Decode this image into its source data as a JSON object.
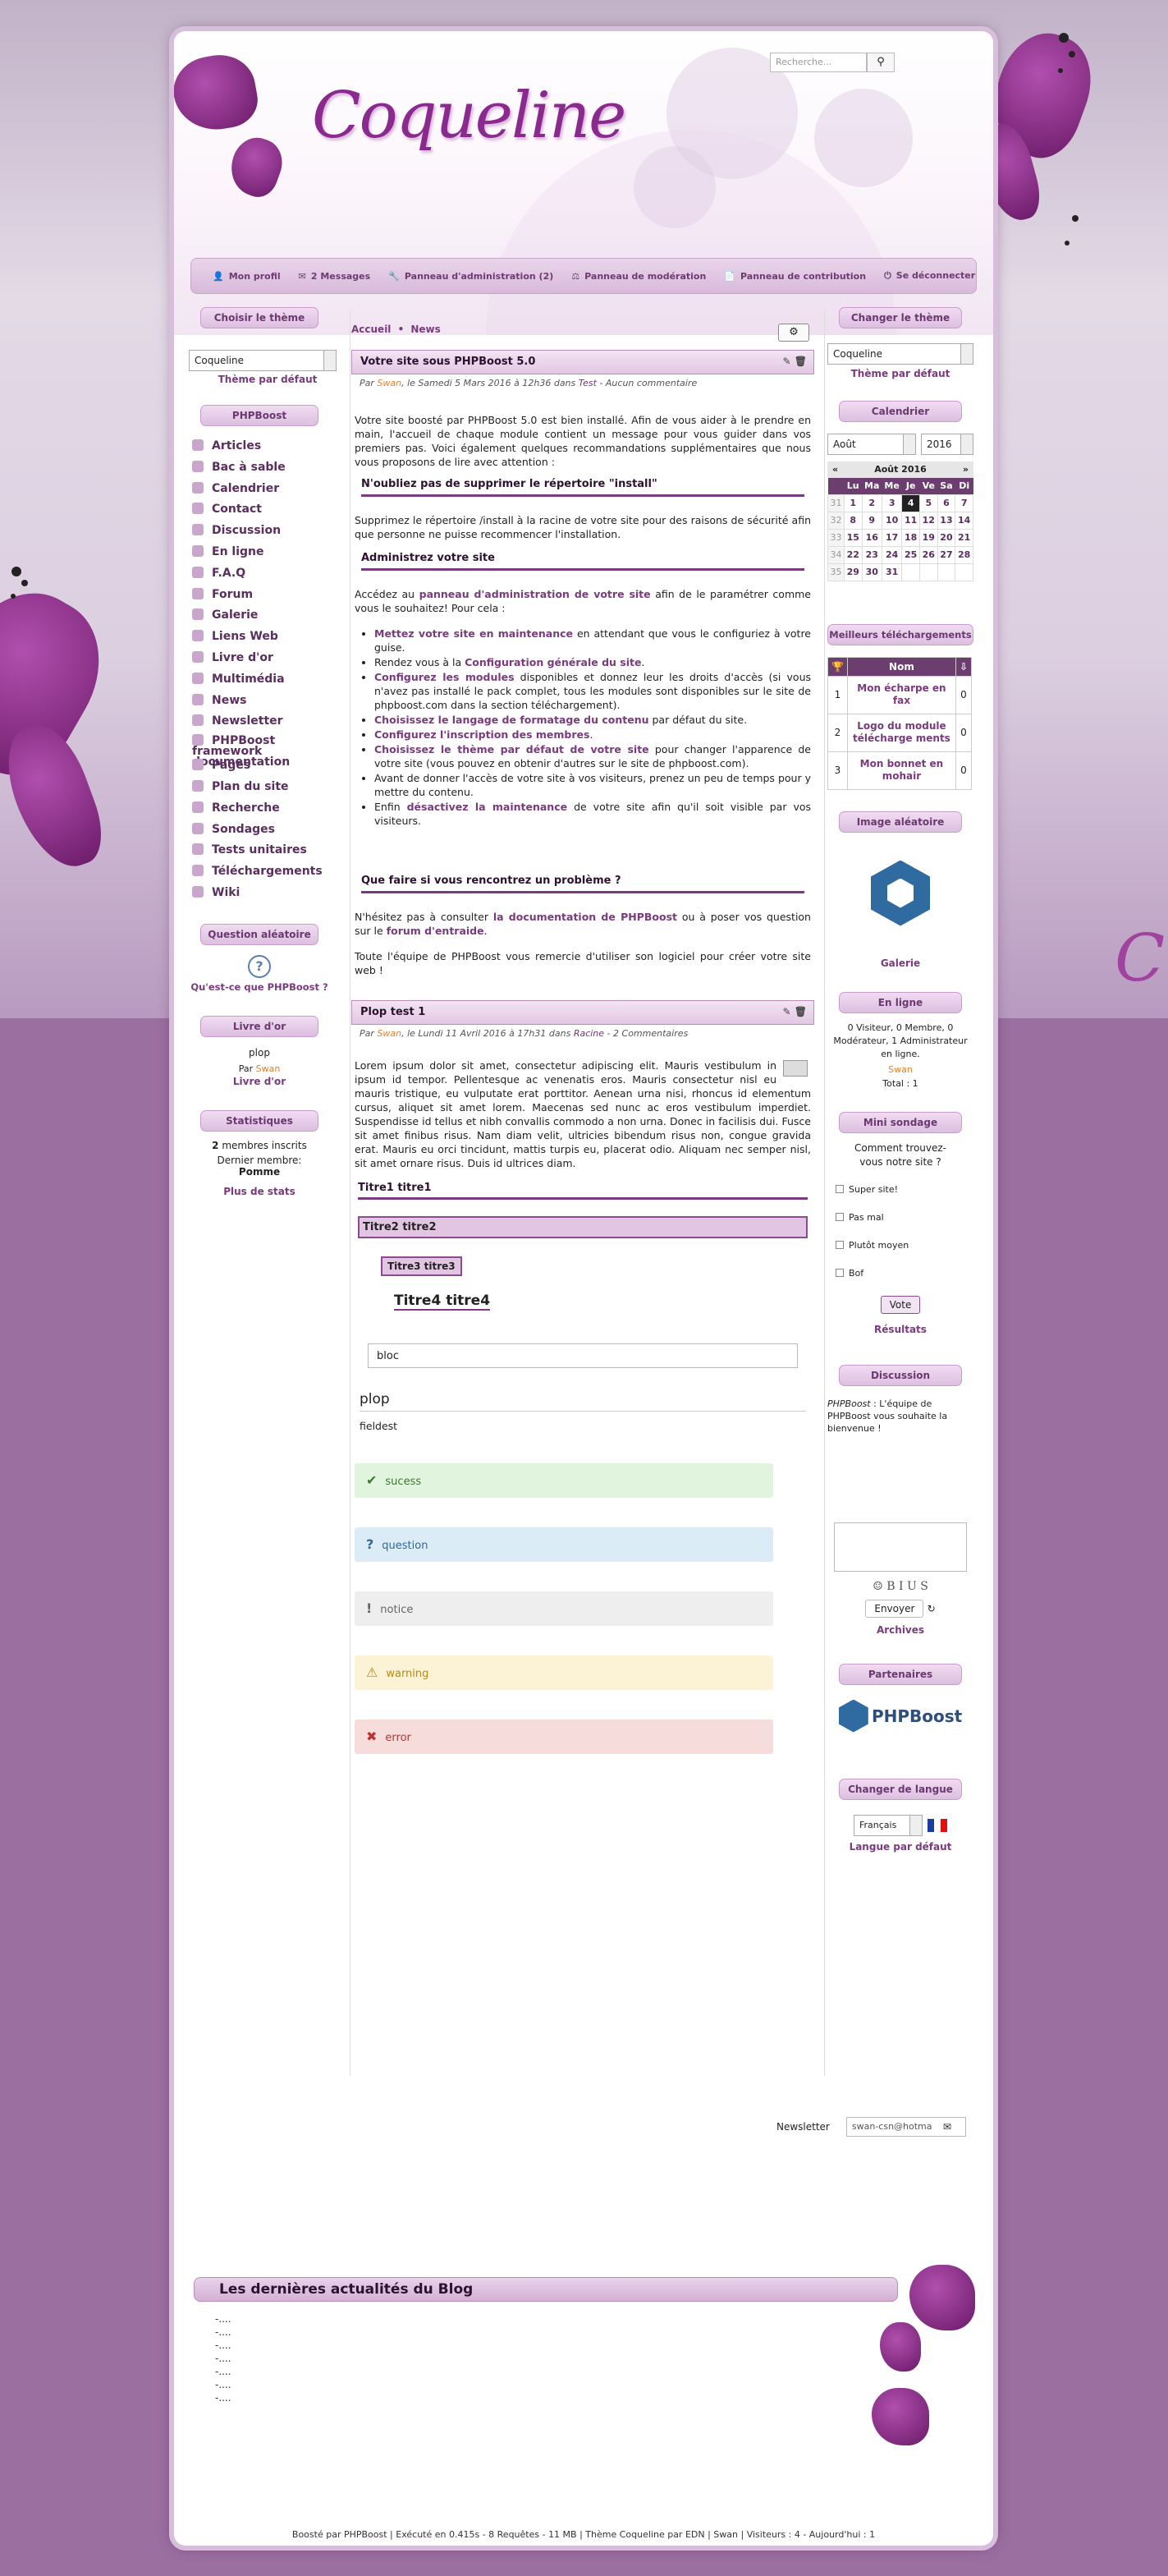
{
  "site": {
    "logo": "Coqueline",
    "search_placeholder": "Recherche..."
  },
  "menu": [
    {
      "icon": "person-icon",
      "label": "Mon profil"
    },
    {
      "icon": "mail-icon",
      "label": "2 Messages"
    },
    {
      "icon": "wrench-icon",
      "label": "Panneau d'administration (2)"
    },
    {
      "icon": "gavel-icon",
      "label": "Panneau de modération"
    },
    {
      "icon": "file-icon",
      "label": "Panneau de contribution"
    },
    {
      "icon": "logout-icon",
      "label": "Se déconnecter"
    }
  ],
  "left": {
    "theme": {
      "title": "Choisir le thème",
      "value": "Coqueline",
      "default_link": "Thème par défaut"
    },
    "phpboost": {
      "title": "PHPBoost",
      "items": [
        "Articles",
        "Bac à sable",
        "Calendrier",
        "Contact",
        "Discussion",
        "En ligne",
        "F.A.Q",
        "Forum",
        "Galerie",
        "Liens Web",
        "Livre d'or",
        "Multimédia",
        "News",
        "Newsletter",
        "PHPBoost framework documentation",
        "Pages",
        "Plan du site",
        "Recherche",
        "Sondages",
        "Tests unitaires",
        "Téléchargements",
        "Wiki"
      ]
    },
    "question": {
      "title": "Question aléatoire",
      "link": "Qu'est-ce que PHPBoost ?"
    },
    "guestbook": {
      "title": "Livre d'or",
      "text": "plop",
      "by": "Par",
      "author": "Swan",
      "link": "Livre d'or"
    },
    "stats": {
      "title": "Statistiques",
      "members_count": "2",
      "members_label": "membres inscrits",
      "last_label": "Dernier membre:",
      "last_name": "Pomme",
      "link": "Plus de stats"
    }
  },
  "breadcrumb": {
    "home": "Accueil",
    "sep": "•",
    "current": "News"
  },
  "articles": [
    {
      "title": "Votre site sous PHPBoost 5.0",
      "meta_by": "Par",
      "author": "Swan",
      "meta_date": ", le Samedi 5 Mars 2016 à 12h36 dans",
      "category": "Test",
      "meta_comments": "- Aucun commentaire"
    },
    {
      "title": "Plop test 1",
      "meta_by": "Par",
      "author": "Swan",
      "meta_date": ", le Lundi 11 Avril 2016 à 17h31 dans",
      "category": "Racine",
      "meta_comments": "- 2 Commentaires"
    }
  ],
  "a1": {
    "p1": "Votre site boosté par PHPBoost 5.0 est bien installé. Afin de vous aider à le prendre en main, l'accueil de chaque module contient un message pour vous guider dans vos premiers pas. Voici également quelques recommandations supplémentaires que nous vous proposons de lire avec attention :",
    "h1": "N'oubliez pas de supprimer le répertoire \"install\"",
    "p2": "Supprimez le répertoire /install à la racine de votre site pour des raisons de sécurité afin que personne ne puisse recommencer l'installation.",
    "h2": "Administrez votre site",
    "p3a": "Accédez au",
    "p3link": "panneau d'administration de votre site",
    "p3b": "afin de le paramétrer comme vous le souhaitez! Pour cela :",
    "list": [
      {
        "link": "Mettez votre site en maintenance",
        "text": " en attendant que vous le configuriez à votre guise."
      },
      {
        "pre": "Rendez vous à la ",
        "link": "Configuration générale du site",
        "text": "."
      },
      {
        "link": "Configurez les modules",
        "text": " disponibles et donnez leur les droits d'accès (si vous n'avez pas installé le pack complet, tous les modules sont disponibles sur le site de phpboost.com dans la section téléchargement)."
      },
      {
        "link": "Choisissez le langage de formatage du contenu",
        "text": " par défaut du site."
      },
      {
        "link": "Configurez l'inscription des membres",
        "text": "."
      },
      {
        "link": "Choisissez le thème par défaut de votre site",
        "text": " pour changer l'apparence de votre site (vous pouvez en obtenir d'autres sur le site de phpboost.com)."
      },
      {
        "text": "Avant de donner l'accès de votre site à vos visiteurs, prenez un peu de temps pour y mettre du contenu."
      },
      {
        "pre": "Enfin ",
        "link": "désactivez la maintenance",
        "text": " de votre site afin qu'il soit visible par vos visiteurs."
      }
    ],
    "h3": "Que faire si vous rencontrez un problème ?",
    "p4a": "N'hésitez pas à consulter",
    "p4link1": "la documentation de PHPBoost",
    "p4b": "ou à poser vos question sur le",
    "p4link2": "forum d'entraide",
    "p5": "Toute l'équipe de PHPBoost vous remercie d'utiliser son logiciel pour créer votre site web !"
  },
  "a2": {
    "lorem": "Lorem ipsum dolor sit amet, consectetur adipiscing elit. Mauris vestibulum in ipsum id tempor. Pellentesque ac venenatis eros. Mauris consectetur nisl eu mauris tristique, eu vulputate erat porttitor. Aenean urna nisi, rhoncus id elementum cursus, aliquet sit amet lorem. Maecenas sed nunc ac eros vestibulum imperdiet. Suspendisse id tellus et nibh convallis commodo a non urna. Donec in facilisis dui. Fusce sit amet finibus risus. Nam diam velit, ultricies bibendum risus non, congue gravida erat. Mauris eu orci tincidunt, mattis turpis eu, placerat odio. Aliquam nec semper nisl, sit amet ornare risus. Duis id ultrices diam.",
    "t1": "Titre1 titre1",
    "t2": "Titre2 titre2",
    "t3": "Titre3 titre3",
    "t4": "Titre4 titre4",
    "bloc": "bloc",
    "legend": "plop",
    "fieldset": "fieldest",
    "msgs": [
      {
        "type": "success",
        "icon": "check-icon",
        "text": "sucess"
      },
      {
        "type": "question",
        "icon": "question-icon",
        "text": "question"
      },
      {
        "type": "notice",
        "icon": "exclamation-icon",
        "text": "notice"
      },
      {
        "type": "warning",
        "icon": "warning-icon",
        "text": "warning"
      },
      {
        "type": "error",
        "icon": "close-icon",
        "text": "error"
      }
    ]
  },
  "right": {
    "theme": {
      "title": "Changer le thème",
      "value": "Coqueline",
      "default_link": "Thème par défaut"
    },
    "calendar": {
      "title": "Calendrier",
      "month": "Août",
      "year": "2016",
      "label": "Août 2016",
      "prev": "«",
      "next": "»",
      "days": [
        "Lu",
        "Ma",
        "Me",
        "Je",
        "Ve",
        "Sa",
        "Di"
      ],
      "weeks": [
        [
          "31",
          "1",
          "2",
          "3",
          "4",
          "5",
          "6",
          "7"
        ],
        [
          "32",
          "8",
          "9",
          "10",
          "11",
          "12",
          "13",
          "14"
        ],
        [
          "33",
          "15",
          "16",
          "17",
          "18",
          "19",
          "20",
          "21"
        ],
        [
          "34",
          "22",
          "23",
          "24",
          "25",
          "26",
          "27",
          "28"
        ],
        [
          "35",
          "29",
          "30",
          "31",
          "",
          "",
          "",
          ""
        ]
      ]
    },
    "downloads": {
      "title": "Meilleurs téléchargements",
      "col": "Nom",
      "rows": [
        [
          "1",
          "Mon écharpe en fax",
          "0"
        ],
        [
          "2",
          "Logo du module télécharge ments",
          "0"
        ],
        [
          "3",
          "Mon bonnet en mohair",
          "0"
        ]
      ]
    },
    "image": {
      "title": "Image aléatoire",
      "link": "Galerie"
    },
    "online": {
      "title": "En ligne",
      "text": "0 Visiteur, 0 Membre, 0 Modérateur, 1 Administrateur en ligne.",
      "user": "Swan",
      "total": "Total : 1"
    },
    "poll": {
      "title": "Mini sondage",
      "question": "Comment trouvez-vous notre site ?",
      "options": [
        "Super site!",
        "Pas mal",
        "Plutôt moyen",
        "Bof"
      ],
      "vote": "Vote",
      "results": "Résultats"
    },
    "discussion": {
      "title": "Discussion",
      "author": "PHPBoost",
      "text": " : L'équipe de PHPBoost vous souhaite la bienvenue !",
      "toolbar": "☺ B I U S",
      "send": "Envoyer",
      "archives": "Archives"
    },
    "partners": {
      "title": "Partenaires",
      "logo": "PHPBoost"
    },
    "lang": {
      "title": "Changer de langue",
      "value": "Français",
      "default_link": "Langue par défaut"
    }
  },
  "newsletter": {
    "label": "Newsletter",
    "value": "swan-csn@hotma"
  },
  "blog": {
    "title": "Les dernières actualités du Blog",
    "items": [
      "-....",
      "-....",
      "-....",
      "-....",
      "-....",
      "-....",
      "-...."
    ]
  },
  "footer": {
    "text": "Boosté par PHPBoost | Exécuté en 0.415s - 8 Requêtes - 11 MB | Thème Coqueline par EDN | Swan | Visiteurs : 4 - Aujourd'hui : 1"
  }
}
